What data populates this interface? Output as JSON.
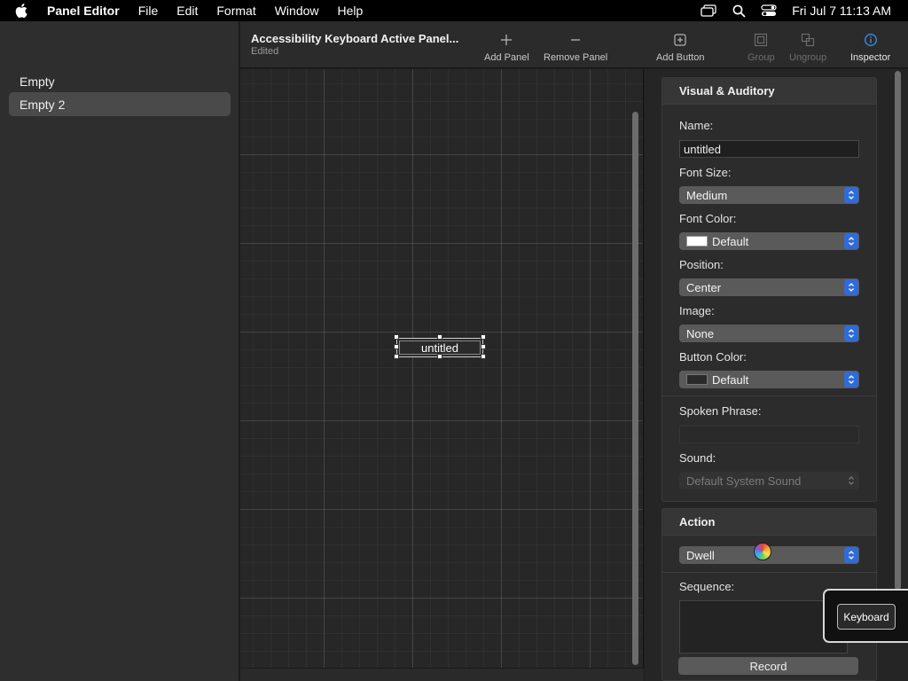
{
  "menubar": {
    "app_name": "Panel Editor",
    "menus": [
      "File",
      "Edit",
      "Format",
      "Window",
      "Help"
    ],
    "clock": "Fri Jul 7  11:13 AM"
  },
  "sidebar": {
    "items": [
      {
        "label": "Empty",
        "selected": false
      },
      {
        "label": "Empty 2",
        "selected": true
      }
    ]
  },
  "toolbar": {
    "title": "Accessibility Keyboard Active Panel...",
    "subtitle": "Edited",
    "add_panel": "Add Panel",
    "remove_panel": "Remove Panel",
    "add_button": "Add Button",
    "group": "Group",
    "ungroup": "Ungroup",
    "inspector": "Inspector"
  },
  "canvas": {
    "button_label": "untitled"
  },
  "inspector": {
    "visual_header": "Visual & Auditory",
    "name_label": "Name:",
    "name_value": "untitled",
    "font_size_label": "Font Size:",
    "font_size_value": "Medium",
    "font_color_label": "Font Color:",
    "font_color_value": "Default",
    "position_label": "Position:",
    "position_value": "Center",
    "image_label": "Image:",
    "image_value": "None",
    "button_color_label": "Button Color:",
    "button_color_value": "Default",
    "spoken_phrase_label": "Spoken Phrase:",
    "spoken_phrase_value": "",
    "sound_label": "Sound:",
    "sound_value": "Default System Sound",
    "action_header": "Action",
    "action_value": "Dwell",
    "sequence_label": "Sequence:",
    "record_label": "Record"
  },
  "popover": {
    "keyboard_label": "Keyboard"
  },
  "colors": {
    "accent": "#2f6bd9",
    "inspector_icon": "#3d8ef0"
  }
}
